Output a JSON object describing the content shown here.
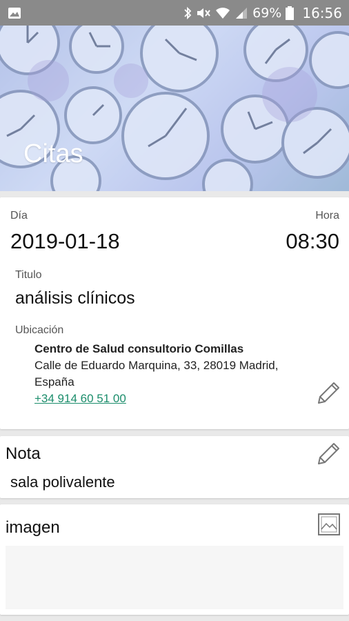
{
  "status_bar": {
    "battery": "69%",
    "time": "16:56",
    "icons": [
      "image-icon",
      "bluetooth-icon",
      "mute-icon",
      "wifi-icon",
      "signal-icon",
      "battery-icon"
    ]
  },
  "header": {
    "title": "Citas"
  },
  "appointment": {
    "day_label": "Día",
    "day_value": "2019-01-18",
    "hour_label": "Hora",
    "hour_value": "08:30",
    "title_label": "Titulo",
    "title_value": "análisis clínicos",
    "location_label": "Ubicación",
    "location_name": "Centro de Salud consultorio Comillas",
    "location_address": "Calle de Eduardo Marquina, 33, 28019 Madrid, España",
    "location_phone": "+34 914 60 51 00"
  },
  "note": {
    "label": "Nota",
    "value": "sala polivalente"
  },
  "image": {
    "label": "imagen"
  },
  "colors": {
    "status_bar": "#8a8a8a",
    "link": "#1b8d6b",
    "background": "#e9e9e9"
  }
}
